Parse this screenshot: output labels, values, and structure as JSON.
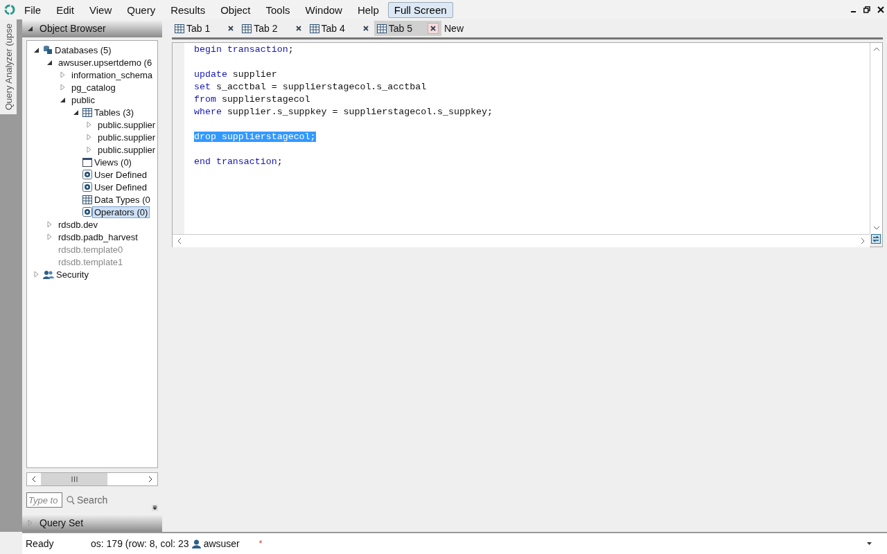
{
  "menu": [
    "File",
    "Edit",
    "View",
    "Query",
    "Results",
    "Object",
    "Tools",
    "Window",
    "Help"
  ],
  "full_screen": {
    "label": "Full Screen",
    "selected": true
  },
  "side_tab": "Query Analyzer (upse",
  "object_browser": {
    "title": "Object Browser",
    "expanded": true,
    "tree": [
      {
        "label": "Databases (5)",
        "kind": "database",
        "expanded": true,
        "selected": false,
        "children": [
          {
            "label": "awsuser.upsertdemo (6",
            "expanded": true,
            "selected": false,
            "children": [
              {
                "label": "information_schema",
                "expanded": false,
                "selected": false
              },
              {
                "label": "pg_catalog",
                "expanded": false,
                "selected": false
              },
              {
                "label": "public",
                "expanded": true,
                "selected": false,
                "children": [
                  {
                    "label": "Tables (3)",
                    "kind": "table",
                    "expanded": true,
                    "selected": false,
                    "children": [
                      {
                        "label": "public.supplier",
                        "expanded": false,
                        "selected": false
                      },
                      {
                        "label": "public.supplier",
                        "expanded": false,
                        "selected": false
                      },
                      {
                        "label": "public.supplier",
                        "expanded": false,
                        "selected": false
                      }
                    ]
                  },
                  {
                    "label": "Views (0)",
                    "kind": "view",
                    "selected": false
                  },
                  {
                    "label": "User Defined",
                    "kind": "gear",
                    "selected": false
                  },
                  {
                    "label": "User Defined",
                    "kind": "gear",
                    "selected": false
                  },
                  {
                    "label": "Data Types (0",
                    "kind": "table",
                    "selected": false
                  },
                  {
                    "label": "Operators (0)",
                    "kind": "gear",
                    "selected": true
                  }
                ]
              }
            ]
          },
          {
            "label": "rdsdb.dev",
            "expanded": false,
            "selected": false
          },
          {
            "label": "rdsdb.padb_harvest",
            "expanded": false,
            "selected": false
          },
          {
            "label": "rdsdb.template0",
            "disabled": true,
            "selected": false
          },
          {
            "label": "rdsdb.template1",
            "disabled": true,
            "selected": false
          }
        ]
      },
      {
        "label": "Security",
        "kind": "users",
        "expanded": false,
        "selected": false
      }
    ],
    "filter_placeholder": "Type to",
    "search": "Search"
  },
  "query_set": {
    "title": "Query Set",
    "expanded": false
  },
  "tabs": [
    {
      "label": "Tab 1",
      "kind": "query",
      "selected": false
    },
    {
      "label": "Tab 2",
      "kind": "query",
      "selected": false
    },
    {
      "label": "Tab 4",
      "kind": "query",
      "selected": false
    },
    {
      "label": "Tab 5",
      "kind": "query",
      "selected": true
    },
    {
      "label": "New",
      "kind": "new",
      "selected": false
    }
  ],
  "editor": {
    "lines": [
      {
        "kind": "code",
        "selected": false,
        "tokens": [
          {
            "text": "begin transaction",
            "kind": "keyword"
          },
          {
            "text": ";",
            "kind": "plain"
          }
        ]
      },
      {
        "kind": "blank"
      },
      {
        "kind": "code",
        "selected": false,
        "tokens": [
          {
            "text": "update",
            "kind": "keyword"
          },
          {
            "text": " supplier",
            "kind": "plain"
          }
        ]
      },
      {
        "kind": "code",
        "selected": false,
        "tokens": [
          {
            "text": "set",
            "kind": "keyword"
          },
          {
            "text": " s_acctbal = supplierstagecol.s_acctbal",
            "kind": "plain"
          }
        ]
      },
      {
        "kind": "code",
        "selected": false,
        "tokens": [
          {
            "text": "from",
            "kind": "keyword"
          },
          {
            "text": " supplierstagecol",
            "kind": "plain"
          }
        ]
      },
      {
        "kind": "code",
        "selected": false,
        "tokens": [
          {
            "text": "where",
            "kind": "keyword"
          },
          {
            "text": " supplier.s_suppkey = supplierstagecol.s_suppkey;",
            "kind": "plain"
          }
        ]
      },
      {
        "kind": "blank"
      },
      {
        "kind": "code",
        "selected": true,
        "tokens": [
          {
            "text": "drop supplierstagecol;",
            "kind": "keyword"
          }
        ]
      },
      {
        "kind": "blank"
      },
      {
        "kind": "code",
        "selected": false,
        "tokens": [
          {
            "text": "end transaction",
            "kind": "keyword"
          },
          {
            "text": ";",
            "kind": "plain"
          }
        ]
      }
    ]
  },
  "status": {
    "state": "Ready",
    "position": "os: 179 (row: 8, col: 23",
    "user": "awsuser",
    "modified": "*"
  }
}
